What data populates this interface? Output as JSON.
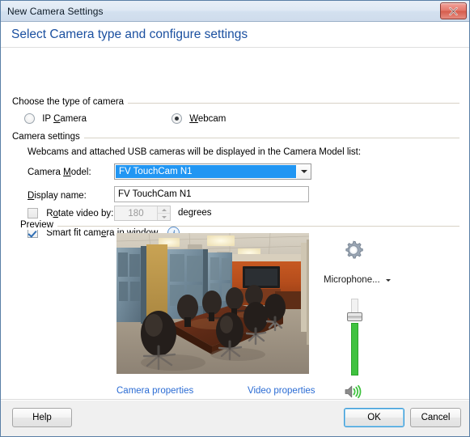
{
  "window": {
    "title": "New Camera Settings",
    "close_icon": "close-icon",
    "header_title": "Select Camera type and configure settings"
  },
  "camera_type_group": {
    "legend": "Choose the type of camera",
    "options": [
      {
        "label_pre": "IP ",
        "label_accel": "C",
        "label_post": "amera",
        "selected": false
      },
      {
        "label_pre": "",
        "label_accel": "W",
        "label_post": "ebcam",
        "selected": true
      }
    ]
  },
  "camera_settings_group": {
    "legend": "Camera settings",
    "hint": "Webcams and attached USB cameras will be displayed in the Camera Model list:",
    "camera_model": {
      "label_pre": "Camera ",
      "label_accel": "M",
      "label_post": "odel:",
      "value": "FV TouchCam N1",
      "arrow_icon": "chevron-down-icon",
      "highlight_color": "#2196f3"
    },
    "display_name": {
      "label_pre": "",
      "label_accel": "D",
      "label_post": "isplay name:",
      "value": "FV TouchCam N1",
      "placeholder": ""
    },
    "rotate": {
      "label_pre": "R",
      "label_accel": "o",
      "label_post": "tate video by:",
      "checked": false,
      "value": "180",
      "unit": "degrees",
      "enabled": false
    },
    "smart_fit": {
      "label_pre": "Smart fit cam",
      "label_accel": "e",
      "label_post": "ra in window",
      "checked": true,
      "info_icon": "info-icon",
      "info_glyph": "i"
    }
  },
  "preview_group": {
    "legend": "Preview",
    "image_alt": "conference-room-preview",
    "links": [
      {
        "text": "Camera properties",
        "name": "camera-properties-link"
      },
      {
        "text": "Video properties",
        "name": "video-properties-link"
      }
    ],
    "controls": {
      "gear_icon": "gear-icon",
      "audio_source": "Microphone...",
      "audio_arrow_icon": "chevron-down-icon",
      "volume_percent": 72,
      "slider_fill_color": "#3fc23f",
      "speaker_icon": "speaker-volume-icon"
    }
  },
  "footer": {
    "help_label": "Help",
    "ok_label": "OK",
    "cancel_label": "Cancel",
    "default_button": "OK",
    "focus_color": "#3c9ad6"
  }
}
